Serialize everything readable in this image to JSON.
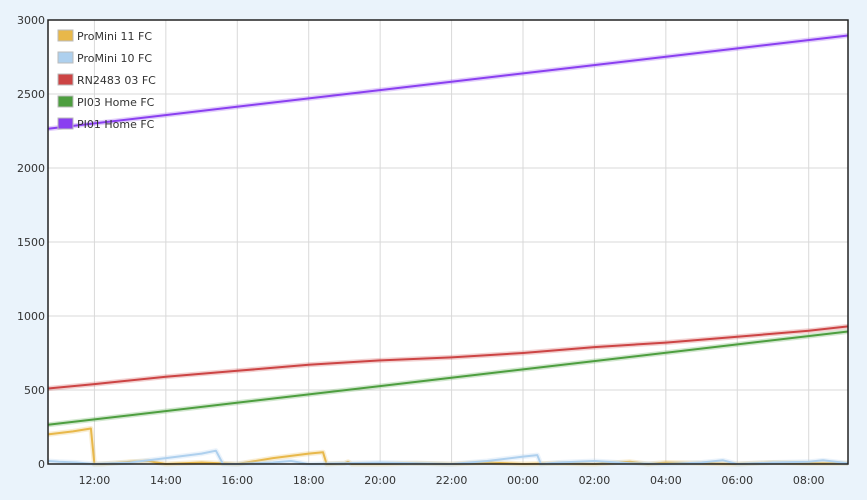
{
  "chart_data": {
    "type": "line",
    "xlabel": "",
    "ylabel": "",
    "ylim": [
      0,
      3000
    ],
    "yticks": [
      0,
      500,
      1000,
      1500,
      2000,
      2500,
      3000
    ],
    "xlim": [
      10.7,
      33.1
    ],
    "xticks": [
      {
        "v": 12,
        "label": "12:00"
      },
      {
        "v": 14,
        "label": "14:00"
      },
      {
        "v": 16,
        "label": "16:00"
      },
      {
        "v": 18,
        "label": "18:00"
      },
      {
        "v": 20,
        "label": "20:00"
      },
      {
        "v": 22,
        "label": "22:00"
      },
      {
        "v": 24,
        "label": "00:00"
      },
      {
        "v": 26,
        "label": "02:00"
      },
      {
        "v": 28,
        "label": "04:00"
      },
      {
        "v": 30,
        "label": "06:00"
      },
      {
        "v": 32,
        "label": "08:00"
      }
    ],
    "grid": true,
    "legend_position": "top-left",
    "series": [
      {
        "name": "ProMini 11 FC",
        "color": "#e8b84a",
        "x": [
          10.7,
          11.4,
          11.9,
          12.0,
          12.2,
          13.0,
          13.5,
          14.0,
          15.0,
          16.0,
          17.0,
          18.0,
          18.4,
          18.5,
          19.0,
          19.1,
          19.2,
          20.0,
          21.0,
          22.0,
          23.0,
          24.0,
          25.0,
          26.0,
          27.0,
          27.5,
          28.0,
          29.0,
          30.0,
          31.0,
          32.0,
          33.1
        ],
        "y": [
          200,
          220,
          240,
          0,
          0,
          15,
          20,
          0,
          10,
          0,
          40,
          70,
          80,
          0,
          5,
          15,
          0,
          0,
          5,
          0,
          10,
          0,
          5,
          0,
          15,
          0,
          10,
          5,
          0,
          10,
          5,
          5
        ]
      },
      {
        "name": "ProMini 10 FC",
        "color": "#aed0ee",
        "x": [
          10.7,
          11.0,
          11.5,
          12.0,
          13.0,
          14.0,
          15.0,
          15.4,
          15.6,
          16.0,
          17.0,
          17.5,
          18.0,
          19.0,
          20.0,
          21.0,
          22.0,
          23.0,
          24.0,
          24.4,
          24.5,
          25.0,
          26.0,
          27.0,
          28.0,
          29.0,
          29.6,
          30.0,
          31.0,
          32.0,
          32.4,
          33.1
        ],
        "y": [
          20,
          15,
          10,
          0,
          10,
          40,
          70,
          90,
          0,
          0,
          10,
          20,
          0,
          5,
          10,
          5,
          0,
          20,
          50,
          60,
          0,
          10,
          20,
          5,
          0,
          10,
          25,
          0,
          10,
          15,
          25,
          5
        ]
      },
      {
        "name": "RN2483 03 FC",
        "color": "#cc4444",
        "x": [
          10.7,
          12.0,
          14.0,
          16.0,
          18.0,
          20.0,
          22.0,
          24.0,
          26.0,
          28.0,
          30.0,
          32.0,
          33.1
        ],
        "y": [
          510,
          540,
          590,
          630,
          670,
          700,
          720,
          750,
          790,
          820,
          860,
          900,
          930
        ]
      },
      {
        "name": "PI03 Home FC",
        "color": "#4d9e3f",
        "x": [
          10.7,
          33.1
        ],
        "y": [
          265,
          895
        ]
      },
      {
        "name": "PI01 Home FC",
        "color": "#8a3ff0",
        "x": [
          10.7,
          33.1
        ],
        "y": [
          2265,
          2895
        ]
      }
    ]
  }
}
